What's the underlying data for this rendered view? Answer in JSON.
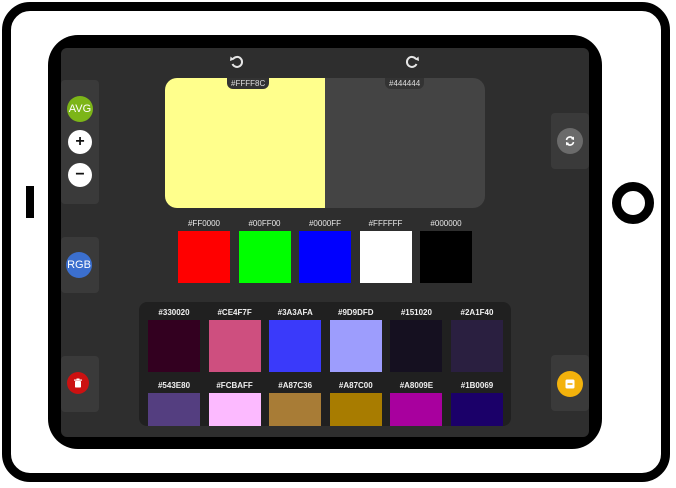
{
  "controls": {
    "avg_label": "AVG",
    "plus_label": "+",
    "minus_label": "−",
    "rgb_label": "RGB",
    "undo_icon": "undo-icon",
    "redo_icon": "redo-icon",
    "swap_icon": "refresh-icon",
    "clear_icon": "trash-icon",
    "collapse_icon": "minus-square-icon"
  },
  "comparison": {
    "left": {
      "hex": "#FFFF8C",
      "color": "#FFFF8C"
    },
    "right": {
      "hex": "#444444",
      "color": "#444444"
    }
  },
  "primaries": [
    {
      "hex": "#FF0000",
      "color": "#FF0000"
    },
    {
      "hex": "#00FF00",
      "color": "#00FF00"
    },
    {
      "hex": "#0000FF",
      "color": "#0000FF"
    },
    {
      "hex": "#FFFFFF",
      "color": "#FFFFFF"
    },
    {
      "hex": "#000000",
      "color": "#000000"
    }
  ],
  "palette": [
    {
      "hex": "#330020",
      "color": "#330020"
    },
    {
      "hex": "#CE4F7F",
      "color": "#CE4F7F"
    },
    {
      "hex": "#3A3AFA",
      "color": "#3A3AFA"
    },
    {
      "hex": "#9D9DFD",
      "color": "#9D9DFD"
    },
    {
      "hex": "#151020",
      "color": "#151020"
    },
    {
      "hex": "#2A1F40",
      "color": "#2A1F40"
    },
    {
      "hex": "#543E80",
      "color": "#543E80"
    },
    {
      "hex": "#FCBAFF",
      "color": "#FCBAFF"
    },
    {
      "hex": "#A87C36",
      "color": "#A87C36"
    },
    {
      "hex": "#A87C00",
      "color": "#A87C00"
    },
    {
      "hex": "#A8009E",
      "color": "#A8009E"
    },
    {
      "hex": "#1B0069",
      "color": "#1B0069"
    }
  ]
}
